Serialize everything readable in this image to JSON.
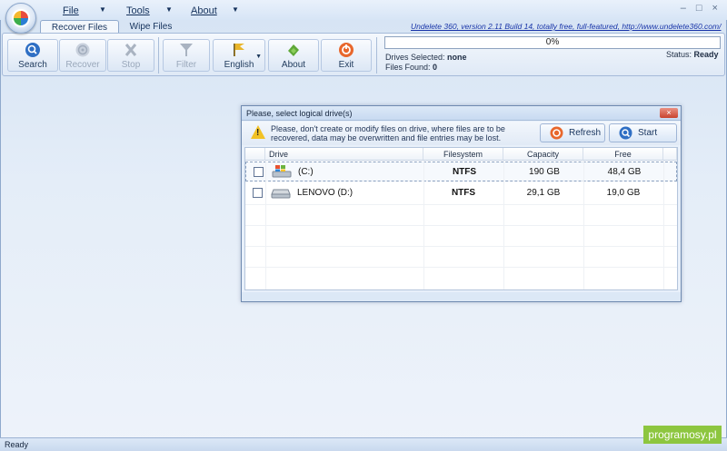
{
  "menu": {
    "file": "File",
    "tools": "Tools",
    "about": "About"
  },
  "window_controls": "– □ ×",
  "tabs": {
    "recover": "Recover Files",
    "wipe": "Wipe Files"
  },
  "title_link": "Undelete 360, version 2.11 Build 14, totally free, full-featured, http://www.undelete360.com/",
  "ribbon": {
    "search": "Search",
    "recover": "Recover",
    "stop": "Stop",
    "filter": "Filter",
    "english": "English",
    "about": "About",
    "exit": "Exit"
  },
  "status_panel": {
    "progress_value": 0,
    "progress_text": "0%",
    "drives_selected_label": "Drives Selected:",
    "drives_selected_value": "none",
    "files_found_label": "Files Found:",
    "files_found_value": "0",
    "status_label": "Status:",
    "status_value": "Ready"
  },
  "dialog": {
    "title": "Please, select logical drive(s)",
    "close": "×",
    "warning": "Please, don't create or modify files on drive, where files are to be recovered, data may be overwritten and file entries may be lost.",
    "refresh": "Refresh",
    "start": "Start",
    "columns": {
      "drive": "Drive",
      "filesystem": "Filesystem",
      "capacity": "Capacity",
      "free": "Free"
    },
    "rows": [
      {
        "drive": "(C:)",
        "filesystem": "NTFS",
        "capacity": "190 GB",
        "free": "48,4 GB",
        "icon": "windows-drive-icon"
      },
      {
        "drive": "LENOVO (D:)",
        "filesystem": "NTFS",
        "capacity": "29,1 GB",
        "free": "19,0 GB",
        "icon": "hard-drive-icon"
      }
    ]
  },
  "statusbar": {
    "text": "Ready"
  },
  "watermark": "programosy.pl",
  "colors": {
    "accent": "#2a6cc5",
    "ribbon_border": "#a5bad9",
    "watermark": "#8dc63f"
  }
}
